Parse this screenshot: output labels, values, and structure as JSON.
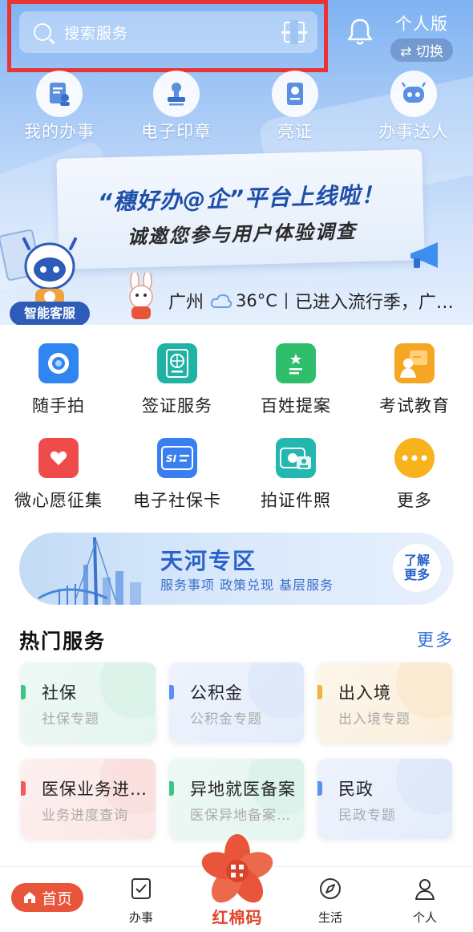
{
  "header": {
    "search_placeholder": "搜索服务",
    "edition_title": "个人版",
    "edition_switch": "⇄ 切换"
  },
  "quick_actions": [
    {
      "label": "我的办事",
      "icon": "document-person-icon"
    },
    {
      "label": "电子印章",
      "icon": "stamp-icon"
    },
    {
      "label": "亮证",
      "icon": "id-card-icon"
    },
    {
      "label": "办事达人",
      "icon": "robot-face-icon"
    }
  ],
  "banner": {
    "line1": "“穗好办@企”平台上线啦！",
    "line2": "诚邀您参与用户体验调查"
  },
  "assistant": {
    "label": "智能客服"
  },
  "weather": {
    "city": "广州",
    "temperature": "36°C",
    "message": "已进入流行季，广…"
  },
  "services": [
    {
      "label": "随手拍",
      "icon": "camera-icon",
      "color": "#2f86f0"
    },
    {
      "label": "签证服务",
      "icon": "passport-icon",
      "color": "#1fb3a5"
    },
    {
      "label": "百姓提案",
      "icon": "proposal-icon",
      "color": "#2fbf6c"
    },
    {
      "label": "考试教育",
      "icon": "exam-icon",
      "color": "#f5a623"
    },
    {
      "label": "微心愿征集",
      "icon": "heart-icon",
      "color": "#ef4b4b"
    },
    {
      "label": "电子社保卡",
      "icon": "social-security-card-icon",
      "color": "#3a7ff0"
    },
    {
      "label": "拍证件照",
      "icon": "id-photo-icon",
      "color": "#22b8b0"
    },
    {
      "label": "更多",
      "icon": "more-dots-icon",
      "color": "#f7b21c"
    }
  ],
  "tianhe": {
    "title": "天河专区",
    "subtitle": "服务事项  政策兑现  基层服务",
    "more_line1": "了解",
    "more_line2": "更多"
  },
  "hot": {
    "title": "热门服务",
    "more": "更多",
    "cards": [
      {
        "title": "社保",
        "subtitle": "社保专题",
        "accent": "#3cc48a"
      },
      {
        "title": "公积金",
        "subtitle": "公积金专题",
        "accent": "#5b8ff2"
      },
      {
        "title": "出入境",
        "subtitle": "出入境专题",
        "accent": "#f2b33d"
      },
      {
        "title": "医保业务进…",
        "subtitle": "业务进度查询",
        "accent": "#ef5a5a"
      },
      {
        "title": "异地就医备案",
        "subtitle": "医保异地备案…",
        "accent": "#3cc48a"
      },
      {
        "title": "民政",
        "subtitle": "民政专题",
        "accent": "#5b8ff2"
      }
    ]
  },
  "tabbar": {
    "home": "首页",
    "affairs": "办事",
    "center": "红棉码",
    "life": "生活",
    "me": "个人"
  }
}
